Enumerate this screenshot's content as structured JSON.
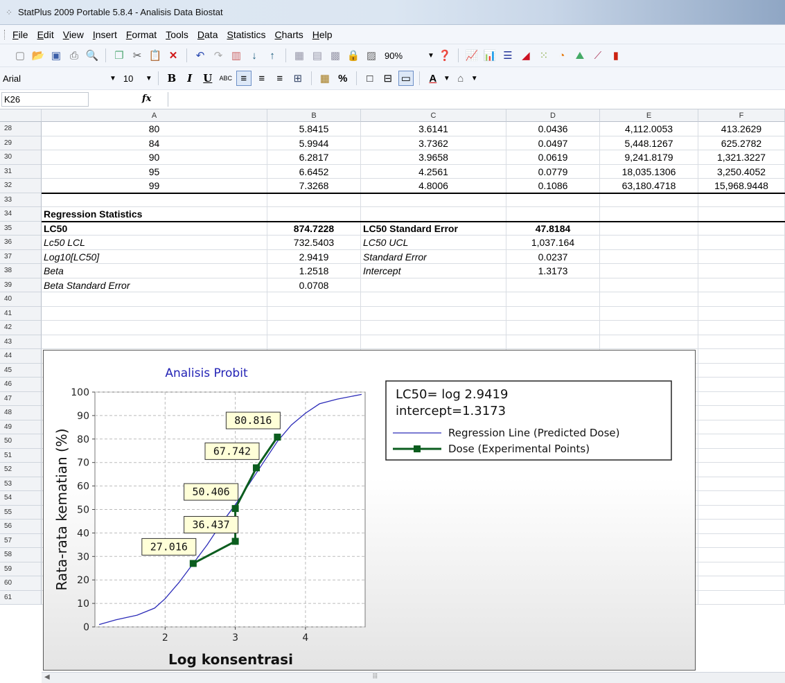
{
  "window": {
    "title": "StatPlus 2009 Portable 5.8.4 - Analisis Data Biostat"
  },
  "menu": [
    "File",
    "Edit",
    "View",
    "Insert",
    "Format",
    "Tools",
    "Data",
    "Statistics",
    "Charts",
    "Help"
  ],
  "toolbar": {
    "zoom": "90%"
  },
  "format_toolbar": {
    "font": "Arial",
    "size": "10"
  },
  "formula": {
    "cell_ref": "K26",
    "fx_label": "fx",
    "content": ""
  },
  "columns": [
    "A",
    "B",
    "C",
    "D",
    "E",
    "F"
  ],
  "rows": [
    {
      "n": "28",
      "a": "80",
      "b": "5.8415",
      "c": "3.6141",
      "d": "0.0436",
      "e": "4,112.0053",
      "f": "413.2629"
    },
    {
      "n": "29",
      "a": "84",
      "b": "5.9944",
      "c": "3.7362",
      "d": "0.0497",
      "e": "5,448.1267",
      "f": "625.2782"
    },
    {
      "n": "30",
      "a": "90",
      "b": "6.2817",
      "c": "3.9658",
      "d": "0.0619",
      "e": "9,241.8179",
      "f": "1,321.3227"
    },
    {
      "n": "31",
      "a": "95",
      "b": "6.6452",
      "c": "4.2561",
      "d": "0.0779",
      "e": "18,035.1306",
      "f": "3,250.4052"
    },
    {
      "n": "32",
      "a": "99",
      "b": "7.3268",
      "c": "4.8006",
      "d": "0.1086",
      "e": "63,180.4718",
      "f": "15,968.9448"
    }
  ],
  "row_numbers": [
    "33",
    "34",
    "35",
    "36",
    "37",
    "38",
    "39",
    "40",
    "41",
    "42",
    "43",
    "44",
    "45",
    "46",
    "47",
    "48",
    "49",
    "50",
    "51",
    "52",
    "53",
    "54",
    "55",
    "56",
    "57",
    "58",
    "59",
    "60",
    "61"
  ],
  "regression": {
    "heading": "Regression Statistics",
    "rows": [
      {
        "a": "LC50",
        "b": "874.7228",
        "c": "LC50 Standard Error",
        "d": "47.8184"
      },
      {
        "a": "Lc50 LCL",
        "b": "732.5403",
        "c": "LC50 UCL",
        "d": "1,037.164"
      },
      {
        "a": "Log10[LC50]",
        "b": "2.9419",
        "c": "Standard Error",
        "d": "0.0237"
      },
      {
        "a": "Beta",
        "b": "1.2518",
        "c": "Intercept",
        "d": "1.3173"
      },
      {
        "a": "Beta Standard Error",
        "b": "0.0708",
        "c": "",
        "d": ""
      }
    ]
  },
  "chart_data": {
    "type": "line",
    "title": "Analisis Probit",
    "xlabel": "Log konsentrasi",
    "ylabel": "Rata-rata kematian (%)",
    "xlim": [
      1,
      4.85
    ],
    "ylim": [
      0,
      100
    ],
    "xticks": [
      "2",
      "3",
      "4"
    ],
    "yticks": [
      "0",
      "10",
      "20",
      "30",
      "40",
      "50",
      "60",
      "70",
      "80",
      "90",
      "100"
    ],
    "grid": true,
    "legend_placement": "right",
    "legend_title_lines": [
      "LC50= log 2.9419",
      "intercept=1.3173"
    ],
    "series": [
      {
        "name": "Regression Line (Predicted Dose)",
        "color": "#2b2bb8",
        "x": [
          1.06,
          1.3,
          1.6,
          1.85,
          2.0,
          2.2,
          2.4,
          2.6,
          2.8,
          3.0,
          3.2,
          3.4,
          3.6,
          3.8,
          4.0,
          4.2,
          4.45,
          4.8
        ],
        "y": [
          1,
          3,
          5,
          8,
          12,
          19,
          27,
          35,
          44,
          52,
          61,
          70,
          79,
          86,
          91,
          95,
          97,
          99
        ]
      },
      {
        "name": "Dose (Experimental Points)",
        "color": "#0b5d1e",
        "x": [
          2.4,
          3.0,
          3.0,
          3.3,
          3.6
        ],
        "y": [
          27.016,
          36.437,
          50.406,
          67.742,
          80.816
        ],
        "labels": [
          "27.016",
          "36.437",
          "50.406",
          "67.742",
          "80.816"
        ]
      }
    ]
  }
}
